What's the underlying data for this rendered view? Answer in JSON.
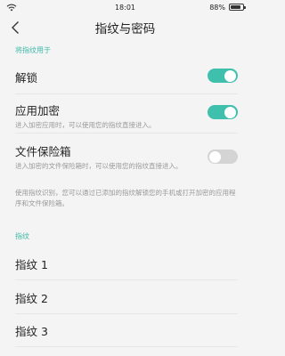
{
  "status": {
    "time": "18:01",
    "battery_text": "88%",
    "battery_level": 0.88
  },
  "header": {
    "title": "指纹与密码"
  },
  "section_use": {
    "label": "将指纹用于"
  },
  "unlock": {
    "label": "解锁",
    "enabled": true
  },
  "app_encrypt": {
    "label": "应用加密",
    "desc": "进入加密应用时，可以使用您的指纹直接进入。",
    "enabled": true
  },
  "file_safe": {
    "label": "文件保险箱",
    "desc": "进入加密的文件保险箱时，可以使用您的指纹直接进入。",
    "enabled": false
  },
  "note": "使用指纹识别，您可以通过已添加的指纹解锁您的手机或打开加密的应用程序和文件保险箱。",
  "section_fp": {
    "label": "指纹"
  },
  "fingerprints": [
    "指纹 1",
    "指纹 2",
    "指纹 3"
  ],
  "colors": {
    "accent": "#3fc0ad",
    "section_label": "#3fb9a8",
    "toggle_off": "#d4d4d4"
  },
  "icons": {
    "back": "chevron-left-icon",
    "wifi": "wifi-icon",
    "battery": "battery-icon"
  }
}
